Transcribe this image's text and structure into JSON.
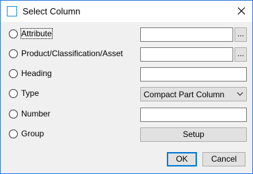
{
  "window": {
    "title": "Select Column",
    "icon": "window-icon",
    "close_icon": "close-icon"
  },
  "options": {
    "attribute": {
      "label": "Attribute",
      "value": "",
      "browse_label": "..."
    },
    "product": {
      "label": "Product/Classification/Asset",
      "value": "",
      "browse_label": "..."
    },
    "heading": {
      "label": "Heading",
      "value": ""
    },
    "type": {
      "label": "Type",
      "selected": "Compact Part Column"
    },
    "number": {
      "label": "Number",
      "value": ""
    },
    "group": {
      "label": "Group",
      "button_label": "Setup"
    }
  },
  "footer": {
    "ok_label": "OK",
    "cancel_label": "Cancel"
  },
  "colors": {
    "accent": "#0078d7",
    "window_border": "#2b78d4",
    "background": "#f0f0f0"
  }
}
